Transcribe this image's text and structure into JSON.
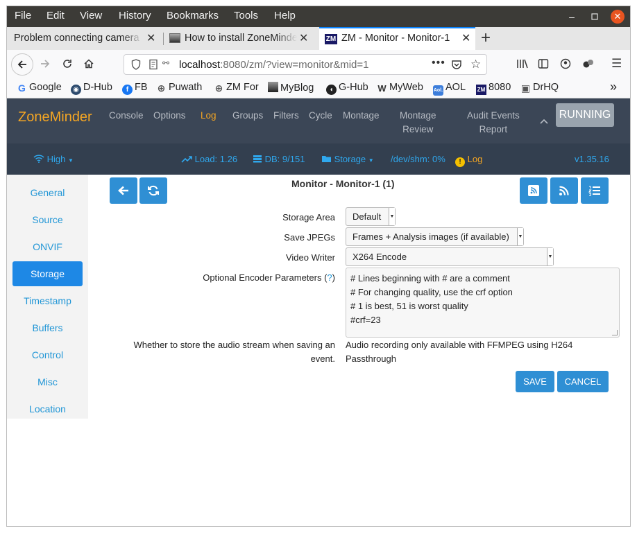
{
  "menubar": {
    "items": [
      "File",
      "Edit",
      "View",
      "History",
      "Bookmarks",
      "Tools",
      "Help"
    ]
  },
  "tabs": [
    {
      "title": "Problem connecting camera",
      "active": false
    },
    {
      "title": "How to install ZoneMinder",
      "active": false
    },
    {
      "title": "ZM - Monitor - Monitor-1",
      "active": true
    }
  ],
  "tab_new_label": "+",
  "urlbar": {
    "host": "localhost",
    "rest": ":8080/zm/?view=monitor&mid=1"
  },
  "bookmarks": [
    {
      "label": "Google",
      "icon": "google-icon",
      "color": "#4285f4"
    },
    {
      "label": "D-Hub",
      "icon": "docker-icon",
      "color": "#2d4b6e"
    },
    {
      "label": "FB",
      "icon": "facebook-icon",
      "color": "#1877f2"
    },
    {
      "label": "Puwath",
      "icon": "globe-icon",
      "color": "#555555"
    },
    {
      "label": "ZM For",
      "icon": "globe-icon",
      "color": "#555555"
    },
    {
      "label": "MyBlog",
      "icon": "blog-icon",
      "color": "#333333"
    },
    {
      "label": "G-Hub",
      "icon": "github-icon",
      "color": "#222222"
    },
    {
      "label": "MyWeb",
      "icon": "web-icon",
      "color": "#333333"
    },
    {
      "label": "AOL",
      "icon": "aol-icon",
      "color": "#3d7edb"
    },
    {
      "label": "8080",
      "icon": "zm-icon",
      "color": "#1a1a66"
    },
    {
      "label": "DrHQ",
      "icon": "box-icon",
      "color": "#666666"
    }
  ],
  "zm": {
    "brand": "ZoneMinder",
    "nav": [
      "Console",
      "Options",
      "Log",
      "Groups",
      "Filters",
      "Cycle",
      "Montage"
    ],
    "nav_montage_review": [
      "Montage",
      "Review"
    ],
    "nav_audit": [
      "Audit Events",
      "Report"
    ],
    "active_nav": "Log",
    "running_label": "RUNNING",
    "status": {
      "bandwidth": "High",
      "load": "Load: 1.26",
      "db": "DB: 9/151",
      "storage": "Storage",
      "shm": "/dev/shm: 0%",
      "log": "Log",
      "version": "v1.35.16"
    },
    "colors": {
      "accent": "#f5a623",
      "link": "#2fa8ee",
      "header": "#333f4f"
    }
  },
  "sidebar": {
    "items": [
      "General",
      "Source",
      "ONVIF",
      "Storage",
      "Timestamp",
      "Buffers",
      "Control",
      "Misc",
      "Location"
    ],
    "active": "Storage"
  },
  "page": {
    "title": "Monitor - Monitor-1 (1)"
  },
  "form": {
    "storage_area_label": "Storage Area",
    "storage_area_value": "Default",
    "save_jpegs_label": "Save JPEGs",
    "save_jpegs_value": "Frames + Analysis images (if available)",
    "video_writer_label": "Video Writer",
    "video_writer_value": "X264 Encode",
    "encoder_params_label": "Optional Encoder Parameters (",
    "encoder_params_help": "?",
    "encoder_params_close": ")",
    "encoder_params_lines": [
      "# Lines beginning with # are a comment",
      "# For changing quality, use the crf option",
      "# 1 is best, 51 is worst quality",
      "#crf=23"
    ],
    "audio_label_line1": "Whether to store the audio stream when saving an",
    "audio_label_line2": "event.",
    "audio_note": "Audio recording only available with FFMPEG using H264 Passthrough"
  },
  "buttons": {
    "save": "SAVE",
    "cancel": "CANCEL"
  }
}
